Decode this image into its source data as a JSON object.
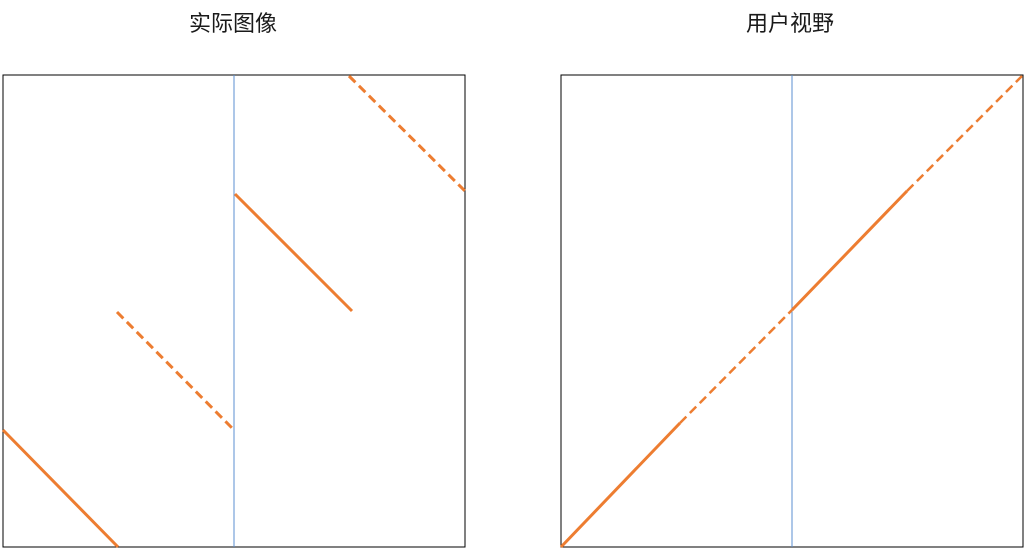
{
  "panels": {
    "left": {
      "title": "实际图像"
    },
    "right": {
      "title": "用户视野"
    }
  },
  "colors": {
    "frame": "#000000",
    "divider": "#5b8fd0",
    "line": "#ed7d31",
    "background": "#ffffff"
  }
}
